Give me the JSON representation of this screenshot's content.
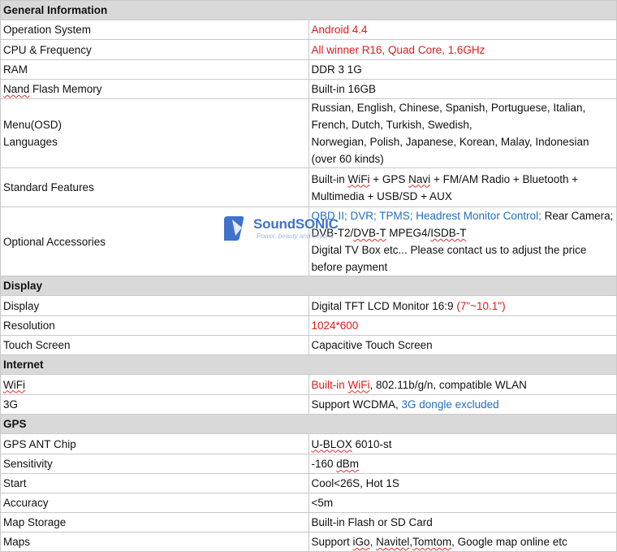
{
  "sections": {
    "general": "General Information",
    "display": "Display",
    "internet": "Internet",
    "gps": "GPS"
  },
  "rows": {
    "os": {
      "label": "Operation System",
      "value": "Android 4.4"
    },
    "cpu": {
      "label": "CPU & Frequency",
      "value": "All winner R16, Quad Core, 1.6GHz"
    },
    "ram": {
      "label": "RAM",
      "value": "DDR 3 1G"
    },
    "nand": {
      "label_a": "Nand",
      "label_b": " Flash Memory",
      "value": "Built-in 16GB"
    },
    "menu": {
      "label_1": "Menu(OSD)",
      "label_2": "Languages",
      "value_1": "Russian,  English, Chinese, Spanish,  Portuguese, Italian, French, Dutch, Turkish, Swedish,",
      "value_2": "Norwegian, Polish, Japanese, Korean, Malay, Indonesian (over 60 kinds)"
    },
    "standard": {
      "label": "Standard Features",
      "v1": "Built-in ",
      "v2": "WiFi",
      "v3": " + GPS ",
      "v4": "Navi",
      "v5": " + FM/AM Radio + Bluetooth + Multimedia + USB/SD + AUX"
    },
    "optional": {
      "label": "Optional Accessories",
      "blue": "OBD II; DVR; TPMS; Headrest Monitor Control;",
      "b1": " Rear Camera;  DVB-T2/",
      "b2": "DVB-T",
      "b3": " MPEG4/",
      "b4": "ISDB-T",
      "line2": "Digital TV Box etc... Please contact us to adjust the price before payment"
    },
    "display": {
      "label": "Display",
      "value": "Digital  TFT LCD Monitor 16:9 ",
      "value_red": "(7\"~10.1\")"
    },
    "resolution": {
      "label": "Resolution",
      "value": "1024*600"
    },
    "touch": {
      "label": "Touch Screen",
      "value": "Capacitive Touch Screen"
    },
    "wifi": {
      "label": "WiFi",
      "v_red_a": "Built-in ",
      "v_red_b": "WiFi",
      "v_rest": ", 802.11b/g/n, compatible WLAN"
    },
    "g3": {
      "label": "3G",
      "value": "Support WCDMA, ",
      "value_blue": "3G dongle excluded"
    },
    "gpsant": {
      "label": "GPS ANT Chip",
      "value_a": "U-BLOX",
      "value_b": " 6010-st"
    },
    "sensitivity": {
      "label": "Sensitivity",
      "value_a": "-160 ",
      "value_b": "dBm"
    },
    "start": {
      "label": "Start",
      "value": "Cool<26S, Hot 1S"
    },
    "accuracy": {
      "label": "Accuracy",
      "value": "<5m"
    },
    "mapstorage": {
      "label": "Map Storage",
      "value": "Built-in Flash or SD Card"
    },
    "maps": {
      "label": "Maps",
      "v1": "Support ",
      "v2": "iGo",
      "v3": ", ",
      "v4": "Navitel",
      "v5": ",",
      "v6": "Tomtom",
      "v7": ",  Google map online etc"
    }
  },
  "watermark": {
    "brand": "SoundSONIC",
    "tagline": "Power, beauty and beyond"
  },
  "colors": {
    "section_bg": "#d9d9d9",
    "red": "#e01a1a",
    "blue": "#1f6fc0",
    "grid": "#c9c9c9"
  }
}
